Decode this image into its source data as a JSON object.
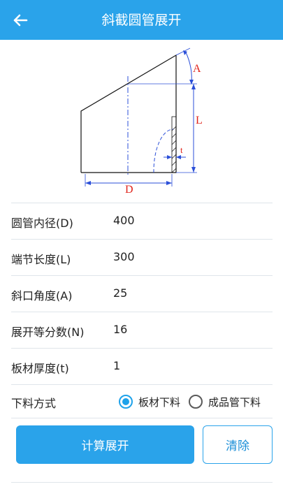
{
  "appbar": {
    "title": "斜截圆管展开",
    "back_icon": "arrow-left-icon"
  },
  "diagram": {
    "label_a": "A",
    "label_l": "L",
    "label_t": "t",
    "label_d": "D"
  },
  "form": {
    "rows": [
      {
        "label": "圆管内径(D)",
        "value": "400"
      },
      {
        "label": "端节长度(L)",
        "value": "300"
      },
      {
        "label": "斜口角度(A)",
        "value": "25"
      },
      {
        "label": "展开等分数(N)",
        "value": "16"
      },
      {
        "label": "板材厚度(t)",
        "value": "1"
      }
    ],
    "method": {
      "label": "下料方式",
      "options": [
        {
          "label": "板材下料",
          "selected": true
        },
        {
          "label": "成品管下料",
          "selected": false
        }
      ]
    }
  },
  "buttons": {
    "calculate": "计算展开",
    "clear": "清除"
  },
  "colors": {
    "primary": "#2aa3ea",
    "dimension": "#1a4fd8",
    "label_red": "#e0241b"
  }
}
